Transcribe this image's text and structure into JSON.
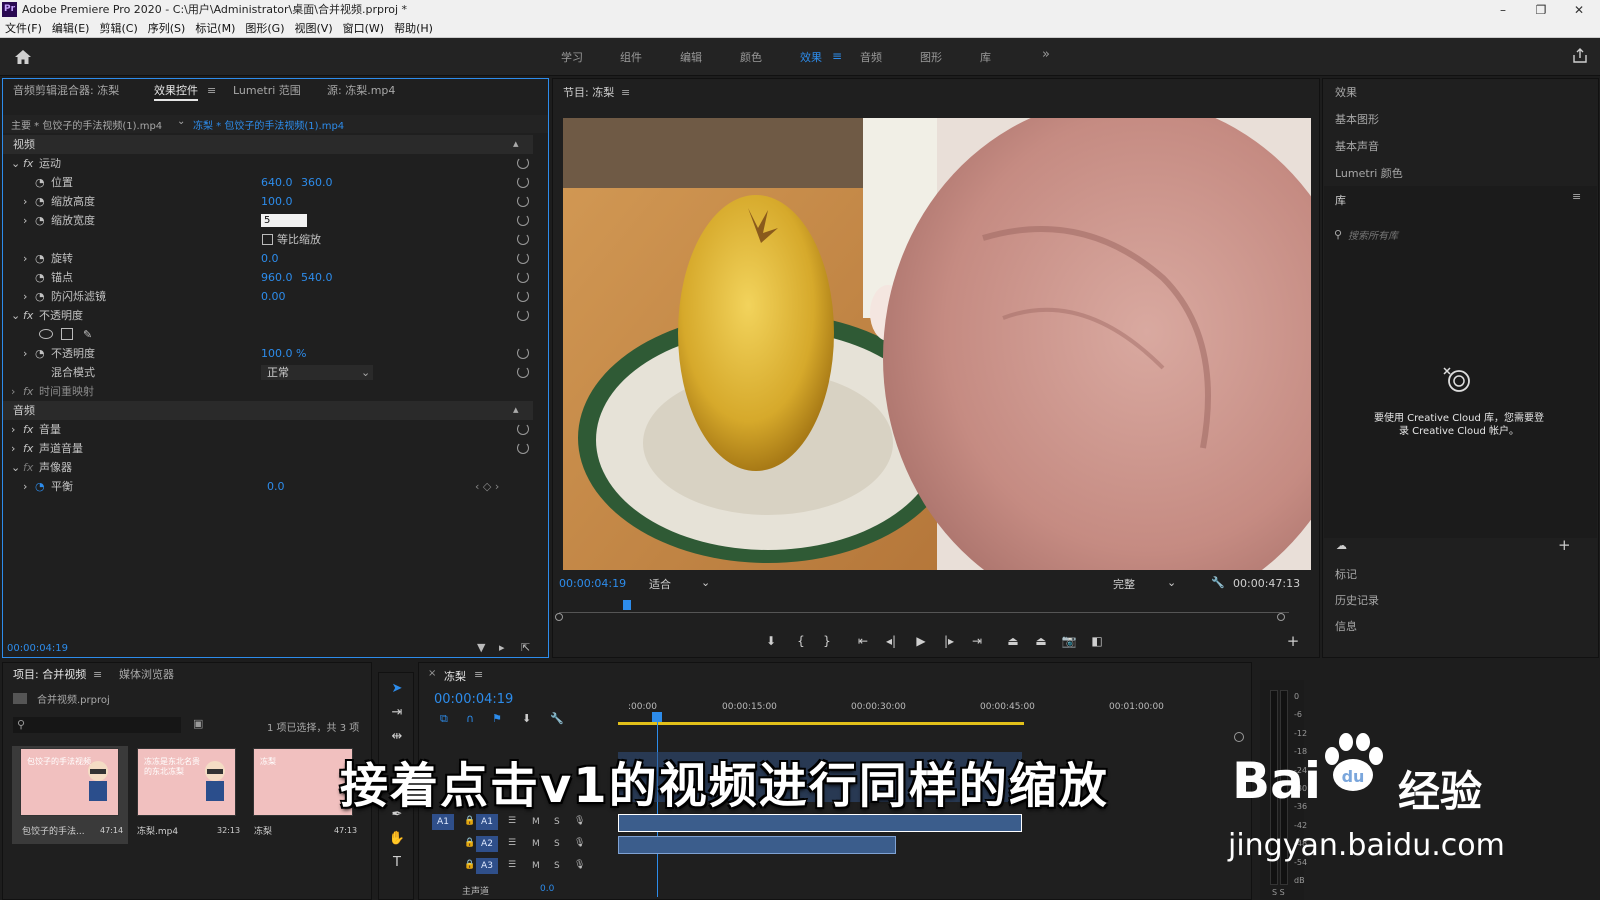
{
  "title": {
    "app_icon": "Pr",
    "text": "Adobe Premiere Pro 2020 - C:\\用户\\Administrator\\桌面\\合并视频.prproj *",
    "minimize": "–",
    "maximize": "❐",
    "close": "✕"
  },
  "menu": [
    "文件(F)",
    "编辑(E)",
    "剪辑(C)",
    "序列(S)",
    "标记(M)",
    "图形(G)",
    "视图(V)",
    "窗口(W)",
    "帮助(H)"
  ],
  "workspaces": [
    "学习",
    "组件",
    "编辑",
    "颜色",
    "效果",
    "音频",
    "图形",
    "库"
  ],
  "workspace_active": "效果",
  "workspace_more": "»",
  "effect_controls": {
    "tabs": [
      "音频剪辑混合器: 冻梨",
      "效果控件",
      "Lumetri 范围",
      "源: 冻梨.mp4"
    ],
    "master": "主要 * 包饺子的手法视频(1).mp4",
    "sequence_clip": "冻梨 * 包饺子的手法视频(1).mp4",
    "video_header": "视频",
    "motion": "运动",
    "position_label": "位置",
    "position_x": "640.0",
    "position_y": "360.0",
    "scale_h_label": "缩放高度",
    "scale_h": "100.0",
    "scale_w_label": "缩放宽度",
    "scale_w_input": "5",
    "uniform_label": "等比缩放",
    "rotation_label": "旋转",
    "rotation": "0.0",
    "anchor_label": "锚点",
    "anchor_x": "960.0",
    "anchor_y": "540.0",
    "flicker_label": "防闪烁滤镜",
    "flicker": "0.00",
    "opacity_header": "不透明度",
    "opacity_label": "不透明度",
    "opacity": "100.0 %",
    "blend_label": "混合模式",
    "blend_value": "正常",
    "time_remap": "时间重映射",
    "audio_header": "音频",
    "volume": "音量",
    "channel_volume": "声道音量",
    "panner": "声像器",
    "balance_label": "平衡",
    "balance": "0.0",
    "timecode": "00:00:04:19"
  },
  "program": {
    "title": "节目: 冻梨",
    "timecode": "00:00:04:19",
    "fit": "适合",
    "quality": "完整",
    "duration": "00:00:47:13"
  },
  "right_panel": {
    "items_top": [
      "效果",
      "基本图形",
      "基本声音",
      "Lumetri 颜色"
    ],
    "library": "库",
    "search_placeholder": "搜索所有库",
    "cc_message_line1": "要使用 Creative Cloud 库，您需要登",
    "cc_message_line2": "录 Creative Cloud 帐户。",
    "items_bottom": [
      "标记",
      "历史记录",
      "信息"
    ]
  },
  "project": {
    "tabs": [
      "项目: 合并视频",
      "媒体浏览器"
    ],
    "file": "合并视频.prproj",
    "selection": "1 项已选择，共 3 项",
    "thumbs": [
      {
        "title": "包饺子的手法...",
        "duration": "47:14",
        "caption": "包饺子的手法视频"
      },
      {
        "title": "冻梨.mp4",
        "duration": "32:13",
        "caption": "冻冻是东北名贵的东北冻梨"
      },
      {
        "title": "冻梨",
        "duration": "47:13",
        "caption": "冻梨"
      }
    ]
  },
  "timeline": {
    "tab": "冻梨",
    "timecode": "00:00:04:19",
    "ruler": [
      ":00:00",
      "00:00:15:00",
      "00:00:30:00",
      "00:00:45:00",
      "00:01:00:00"
    ],
    "tracks": [
      "A1",
      "A2",
      "A3"
    ],
    "master": "主声道",
    "master_value": "0.0",
    "meter": [
      "0",
      "-6",
      "-12",
      "-18",
      "-24",
      "-30",
      "-36",
      "-42",
      "-48",
      "-54",
      "dB"
    ],
    "meter_s": "S S"
  },
  "subtitle": "接着点击v1的视频进行同样的缩放",
  "watermark": {
    "brand_a": "Bai",
    "brand_b": "du",
    "jingyan": "经验",
    "url": "jingyan.baidu.com"
  }
}
